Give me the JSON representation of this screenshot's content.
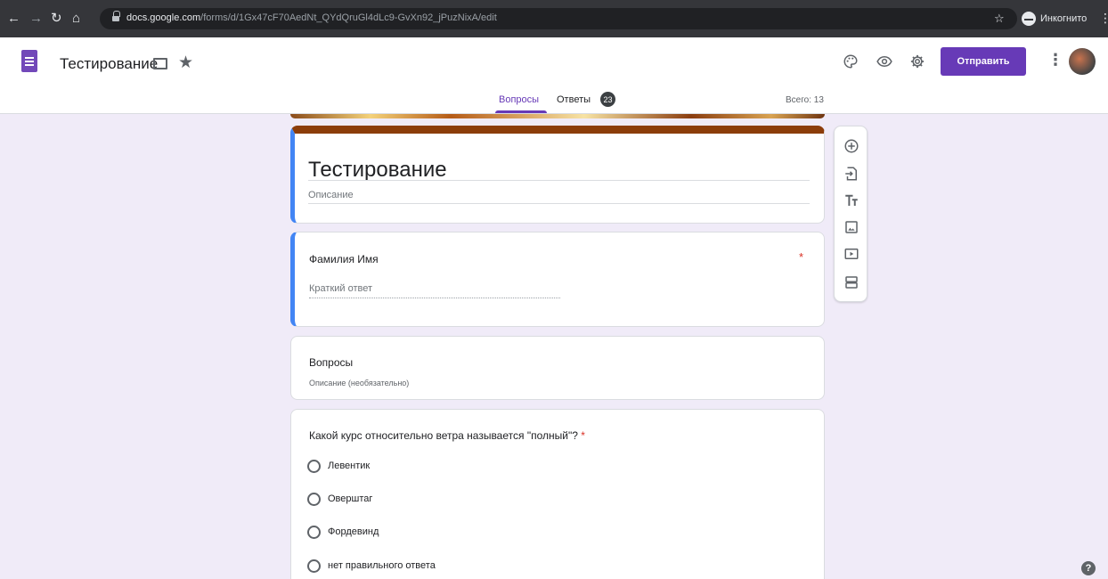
{
  "browser": {
    "url_host": "docs.google.com",
    "url_path": "/forms/d/1Gx47cF70AedNt_QYdQruGl4dLc9-GvXn92_jPuzNixA/edit",
    "incognito_label": "Инкогнито"
  },
  "header": {
    "title": "Тестирование",
    "send_label": "Отправить",
    "tabs": [
      {
        "label": "Вопросы"
      },
      {
        "label": "Ответы",
        "count": "23"
      }
    ],
    "total": "Всего: 13"
  },
  "form": {
    "title": "Тестирование",
    "description_placeholder": "Описание"
  },
  "question1": {
    "title": "Фамилия Имя",
    "required_mark": "*",
    "answer_placeholder": "Краткий ответ"
  },
  "section": {
    "title": "Вопросы",
    "description": "Описание (необязательно)"
  },
  "question2": {
    "title": "Какой курс относительно ветра называется \"полный\"?",
    "required_mark": "*",
    "options": [
      "Левентик",
      "Оверштаг",
      "Фордевинд",
      "нет правильного ответа"
    ]
  },
  "colors": {
    "accent": "#673ab7",
    "active_border": "#4285f4",
    "theme_header": "#8c3d0a",
    "required": "#d93025",
    "background": "#f0ebf8"
  },
  "icons": [
    "palette-icon",
    "preview-eye-icon",
    "settings-gear-icon",
    "more-vert-icon",
    "add-question-icon",
    "import-questions-icon",
    "add-title-icon",
    "add-image-icon",
    "add-video-icon",
    "add-section-icon",
    "help-icon"
  ]
}
